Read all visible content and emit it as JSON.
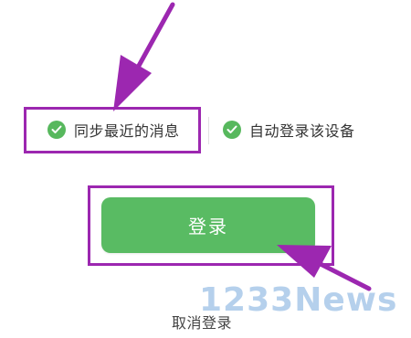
{
  "options": {
    "sync_recent_messages": {
      "label": "同步最近的消息",
      "checked": true
    },
    "auto_login_device": {
      "label": "自动登录该设备",
      "checked": true
    }
  },
  "buttons": {
    "login": "登录",
    "cancel_login": "取消登录"
  },
  "watermark": "1233News",
  "colors": {
    "accent_green": "#59bb63",
    "check_green": "#57b85d",
    "highlight_purple": "#9c27b0"
  },
  "icons": {
    "check": "check-circle-icon"
  }
}
